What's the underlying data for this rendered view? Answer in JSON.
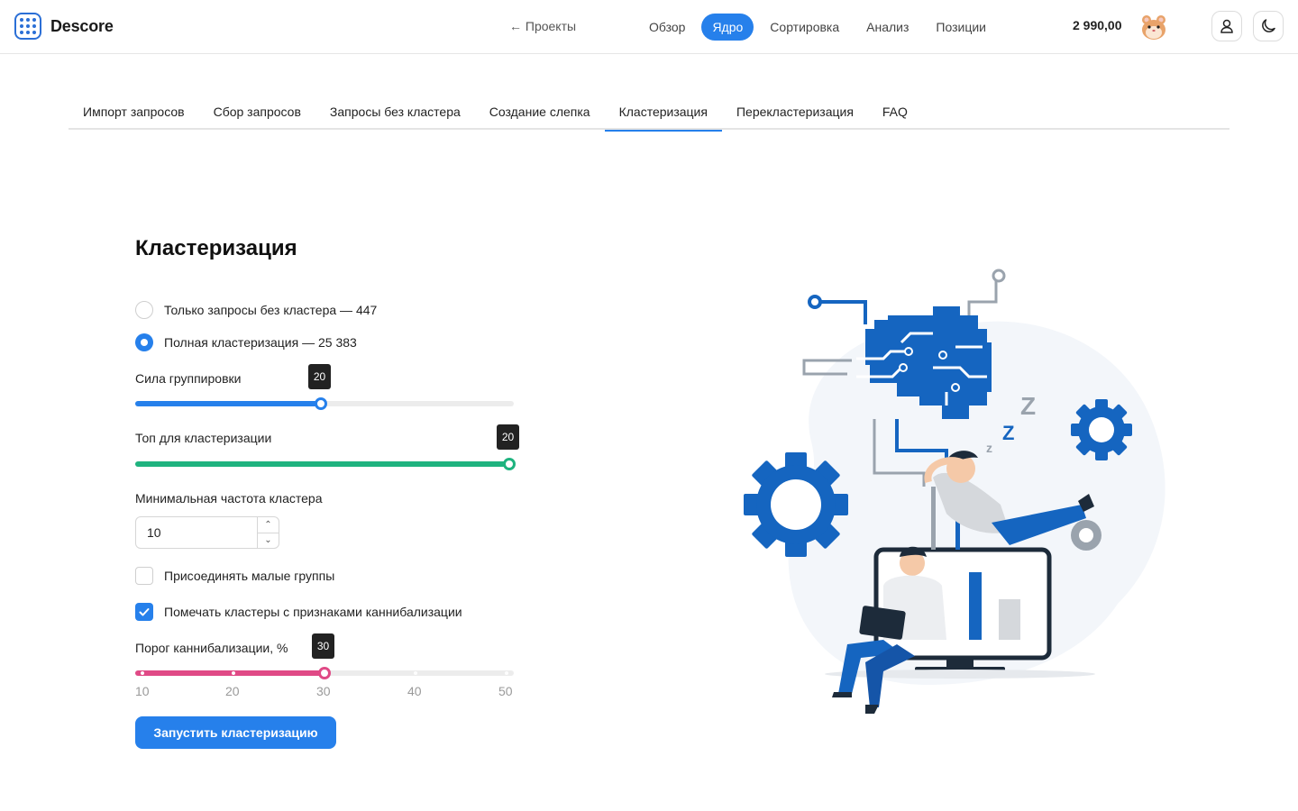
{
  "header": {
    "logo_text": "Descore",
    "back_label": "← Проекты",
    "nav": [
      {
        "label": "Обзор",
        "active": false
      },
      {
        "label": "Ядро",
        "active": true
      },
      {
        "label": "Сортировка",
        "active": false
      },
      {
        "label": "Анализ",
        "active": false
      },
      {
        "label": "Позиции",
        "active": false
      }
    ],
    "balance": "2 990,00"
  },
  "tabs": [
    {
      "label": "Импорт запросов",
      "active": false
    },
    {
      "label": "Сбор запросов",
      "active": false
    },
    {
      "label": "Запросы без кластера",
      "active": false
    },
    {
      "label": "Создание слепка",
      "active": false
    },
    {
      "label": "Кластеризация",
      "active": true
    },
    {
      "label": "Перекластеризация",
      "active": false
    },
    {
      "label": "FAQ",
      "active": false
    }
  ],
  "form": {
    "title": "Кластеризация",
    "radio_only_unclustered": "Только запросы без кластера — 447",
    "radio_full": "Полная кластеризация — 25 383",
    "grouping_strength": {
      "label": "Сила группировки",
      "value": "20",
      "fraction": 0.49,
      "color": "#2680eb"
    },
    "top_for_clustering": {
      "label": "Топ для кластеризации",
      "value": "20",
      "fraction": 1.0,
      "color": "#1fb37f"
    },
    "min_cluster_freq": {
      "label": "Минимальная частота кластера",
      "value": "10"
    },
    "attach_small_groups": {
      "label": "Присоединять малые группы",
      "checked": false
    },
    "mark_cannibalization": {
      "label": "Помечать кластеры с признаками каннибализации",
      "checked": true
    },
    "cannibal_threshold": {
      "label": "Порог каннибализации, %",
      "value": "30",
      "fraction": 0.5,
      "color": "#e04a86",
      "marks": [
        "10",
        "20",
        "30",
        "40",
        "50"
      ]
    },
    "run_button": "Запустить кластеризацию"
  },
  "colors": {
    "accent": "#2680eb",
    "green": "#1fb37f",
    "pink": "#e04a86"
  }
}
